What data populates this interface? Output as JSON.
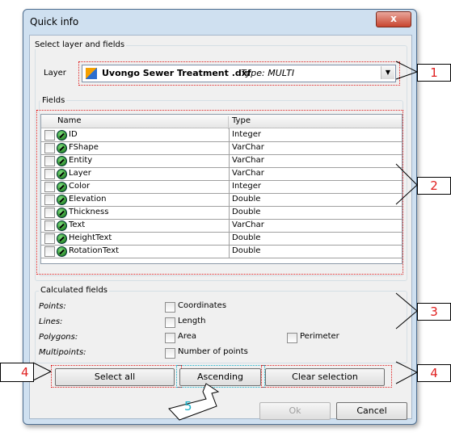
{
  "window": {
    "title": "Quick info",
    "close_glyph": "x"
  },
  "select_group": {
    "label": "Select layer and fields",
    "layer_label": "Layer",
    "layer_value": "Uvongo Sewer Treatment .dxf",
    "layer_type": "Type: MULTI"
  },
  "fields": {
    "label": "Fields",
    "col_name": "Name",
    "col_type": "Type",
    "rows": [
      {
        "name": "ID",
        "type": "Integer"
      },
      {
        "name": "FShape",
        "type": "VarChar"
      },
      {
        "name": "Entity",
        "type": "VarChar"
      },
      {
        "name": "Layer",
        "type": "VarChar"
      },
      {
        "name": "Color",
        "type": "Integer"
      },
      {
        "name": "Elevation",
        "type": "Double"
      },
      {
        "name": "Thickness",
        "type": "Double"
      },
      {
        "name": "Text",
        "type": "VarChar"
      },
      {
        "name": "HeightText",
        "type": "Double"
      },
      {
        "name": "RotationText",
        "type": "Double"
      }
    ]
  },
  "calculated": {
    "label": "Calculated fields",
    "points_label": "Points:",
    "lines_label": "Lines:",
    "polygons_label": "Polygons:",
    "multipoints_label": "Multipoints:",
    "coordinates": "Coordinates",
    "length": "Length",
    "area": "Area",
    "perimeter": "Perimeter",
    "number_of_points": "Number of points"
  },
  "buttons": {
    "select_all": "Select all",
    "ascending": "Ascending",
    "clear_selection": "Clear selection",
    "ok": "Ok",
    "cancel": "Cancel"
  },
  "callouts": {
    "c1": "1",
    "c2": "2",
    "c3": "3",
    "c4_left": "4",
    "c4_right": "4",
    "c5": "5"
  },
  "colors": {
    "annotation_red": "#e02020",
    "callout_cyan": "#17b0c8"
  }
}
